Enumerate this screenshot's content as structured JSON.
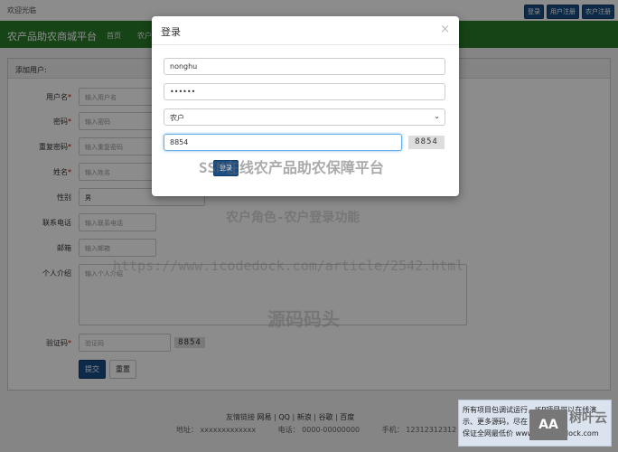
{
  "topbar": {
    "welcome": "欢迎光临",
    "buttons": [
      "登录",
      "用户注册",
      "农户注册"
    ]
  },
  "nav": {
    "brand": "农产品助农商城平台",
    "links": [
      "首页",
      "农户"
    ]
  },
  "form": {
    "heading": "添加用户:",
    "fields": [
      {
        "label": "用户名",
        "placeholder": "输入用户名",
        "required": true
      },
      {
        "label": "密码",
        "placeholder": "输入密码",
        "required": true
      },
      {
        "label": "重复密码",
        "placeholder": "输入重复密码",
        "required": true
      },
      {
        "label": "姓名",
        "placeholder": "输入姓名",
        "required": true
      },
      {
        "label": "性别",
        "value": "男"
      },
      {
        "label": "联系电话",
        "placeholder": "输入联系电话"
      },
      {
        "label": "邮箱",
        "placeholder": "输入邮箱"
      },
      {
        "label": "个人介绍",
        "placeholder": "输入个人介绍"
      },
      {
        "label": "验证码",
        "placeholder": "验证码",
        "required": true
      }
    ],
    "captcha": "8854",
    "submit_label": "提交",
    "reset_label": "重置"
  },
  "footer": {
    "links_label": "友情链接",
    "links": [
      "网易",
      "QQ",
      "新浪",
      "谷歌",
      "百度"
    ],
    "address": "地址： xxxxxxxxxxxxx",
    "phone": "电话： 0000-00000000",
    "mobile": "手机： 12312312312"
  },
  "modal": {
    "title": "登录",
    "close_glyph": "×",
    "username": "nonghu",
    "password": "••••••",
    "role": "农户",
    "captcha_input": "8854",
    "captcha_image": "8854",
    "login_label": "登录"
  },
  "watermarks": {
    "line1": "SSM在线农产品助农保障平台",
    "line2": "农户角色-农户登录功能",
    "line3": "https://www.icodedock.com/article/2542.html",
    "line4": "源码码头"
  },
  "promo": {
    "line1": "所有项目包调试运行，JSP项目可以在线演",
    "line2": "示、更多源码，尽在",
    "line3": "保证全网最低价 www.",
    "line3b": "dock.com",
    "logo": "树叶云",
    "logo_box": "AA"
  },
  "colors": {
    "nav_green": "#2b7d2b",
    "primary_blue": "#1a4e86",
    "required_red": "#cc0000"
  }
}
